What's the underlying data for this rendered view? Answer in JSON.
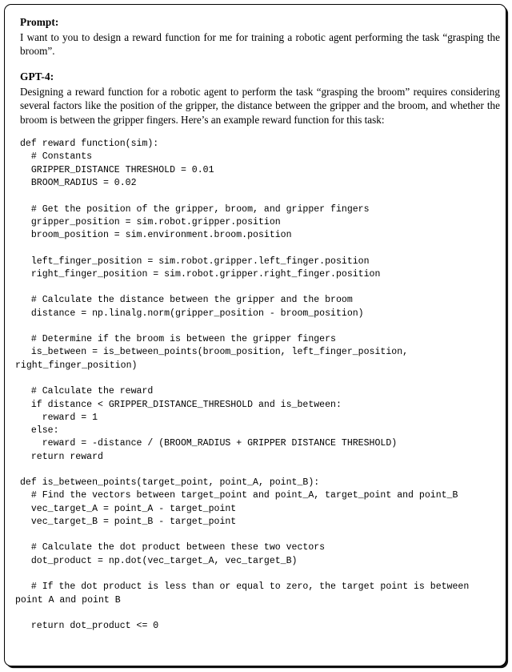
{
  "document": {
    "frame": {
      "style": "rounded-box",
      "border_color": "#000000",
      "background": "#ffffff"
    },
    "sections": [
      {
        "heading": "Prompt:",
        "paragraphs": [
          "I want to you to design a reward function for me for training a robotic agent performing the task “grasping the broom”."
        ]
      },
      {
        "heading": "GPT-4:",
        "paragraphs": [
          "Designing a reward function for a robotic agent to perform the task “grasping the broom” requires considering several factors like the position of the gripper, the distance between the gripper and the broom, and whether the broom is between the gripper fingers. Here’s an example reward function for this task:"
        ]
      }
    ],
    "code_block": {
      "language": "python",
      "lines": [
        "def reward function(sim):",
        "  # Constants",
        "  GRIPPER_DISTANCE THRESHOLD = 0.01",
        "  BROOM_RADIUS = 0.02",
        "",
        "  # Get the position of the gripper, broom, and gripper fingers",
        "  gripper_position = sim.robot.gripper.position",
        "  broom_position = sim.environment.broom.position",
        "",
        "  left_finger_position = sim.robot.gripper.left_finger.position",
        "  right_finger_position = sim.robot.gripper.right_finger.position",
        "",
        "  # Calculate the distance between the gripper and the broom",
        "  distance = np.linalg.norm(gripper_position - broom_position)",
        "",
        "  # Determine if the broom is between the gripper fingers",
        "  is_between = is_between_points(broom_position, left_finger_position,",
        "right_finger_position)",
        "",
        "  # Calculate the reward",
        "  if distance < GRIPPER_DISTANCE_THRESHOLD and is_between:",
        "    reward = 1",
        "  else:",
        "    reward = -distance / (BROOM_RADIUS + GRIPPER DISTANCE THRESHOLD)",
        "  return reward",
        "",
        "def is_between_points(target_point, point_A, point_B):",
        "  # Find the vectors between target_point and point_A, target_point and point_B",
        "  vec_target_A = point_A - target_point",
        "  vec_target_B = point_B - target_point",
        "",
        "  # Calculate the dot product between these two vectors",
        "  dot_product = np.dot(vec_target_A, vec_target_B)",
        "",
        "  # If the dot product is less than or equal to zero, the target point is between",
        "point A and point B",
        "",
        "  return dot_product <= 0"
      ],
      "wrapped_line_indices": [
        17,
        35
      ]
    }
  }
}
